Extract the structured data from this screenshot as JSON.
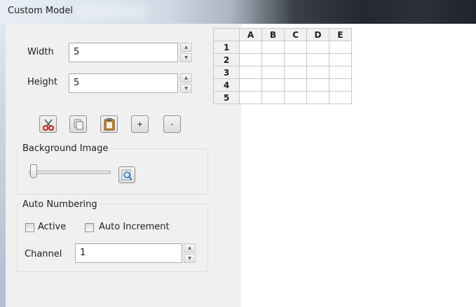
{
  "window": {
    "title": "Custom Model"
  },
  "dimensions": {
    "width_label": "Width",
    "width_value": "5",
    "height_label": "Height",
    "height_value": "5"
  },
  "toolbar": {
    "buttons": [
      {
        "name": "cut",
        "icon": "scissors-icon"
      },
      {
        "name": "copy",
        "icon": "copy-icon"
      },
      {
        "name": "paste",
        "icon": "paste-icon"
      },
      {
        "name": "add",
        "label": "+"
      },
      {
        "name": "remove",
        "label": "-"
      }
    ]
  },
  "background_image": {
    "group_label": "Background Image",
    "slider_value": 0,
    "browse_icon": "magnifier-icon"
  },
  "auto_numbering": {
    "group_label": "Auto Numbering",
    "active_label": "Active",
    "active_checked": false,
    "auto_increment_label": "Auto Increment",
    "auto_increment_checked": false,
    "channel_label": "Channel",
    "channel_value": "1"
  },
  "grid": {
    "columns": [
      "A",
      "B",
      "C",
      "D",
      "E"
    ],
    "rows": [
      "1",
      "2",
      "3",
      "4",
      "5"
    ]
  },
  "colors": {
    "panel_bg": "#f0f0f0",
    "cut_icon": "#cc1f1f",
    "paste_icon": "#c98a2a"
  }
}
